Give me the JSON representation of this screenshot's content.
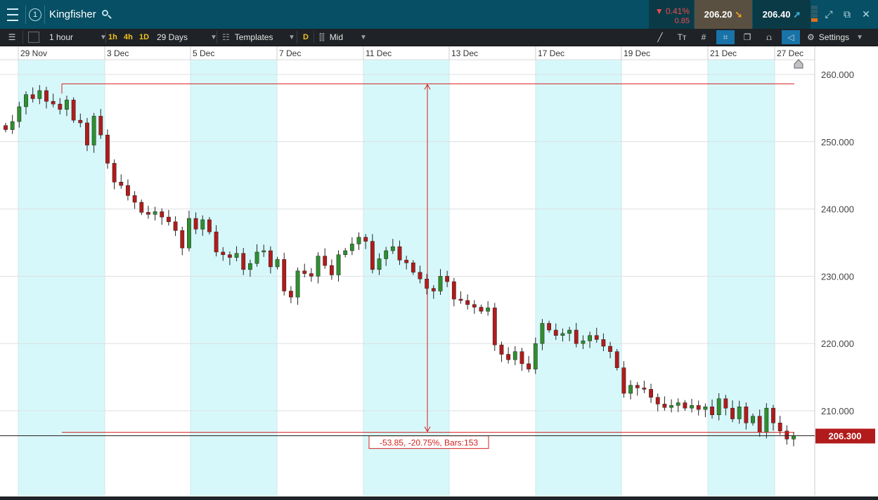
{
  "header": {
    "instrument": "Kingfisher",
    "window_number": "1",
    "change_pct": "▼ 0.41%",
    "change_abs": "0.85",
    "sell_price": "206.20",
    "buy_price": "206.40"
  },
  "toolbar": {
    "interval": "1 hour",
    "quick_1h": "1h",
    "quick_4h": "4h",
    "quick_1d": "1D",
    "range": "29 Days",
    "templates": "Templates",
    "d_button": "D",
    "price_type": "Mid",
    "settings": "Settings"
  },
  "colors": {
    "header_bg": "#064f64",
    "toolbar_bg": "#1f2226",
    "up_candle": "#2f8f2f",
    "down_candle": "#b21b1b",
    "day_band": "#d7f8fa",
    "measure_line": "#d42020",
    "price_tag": "#b21b1b"
  },
  "chart_data": {
    "type": "candlestick",
    "x_labels": [
      "29 Nov",
      "3 Dec",
      "5 Dec",
      "7 Dec",
      "11 Dec",
      "13 Dec",
      "17 Dec",
      "19 Dec",
      "21 Dec",
      "27 Dec"
    ],
    "ylim": [
      200.0,
      262.0
    ],
    "y_ticks": [
      260.0,
      250.0,
      240.0,
      230.0,
      220.0,
      210.0
    ],
    "y_tick_labels": [
      "260.000",
      "250.000",
      "240.000",
      "230.000",
      "220.000",
      "210.000"
    ],
    "last_price": 206.3,
    "last_price_label": "206.300",
    "measurement": {
      "high": 258.6,
      "low": 206.8,
      "label": "-53.85, -20.75%, Bars:153"
    },
    "closes": [
      251.8,
      253.0,
      255.2,
      257.0,
      256.4,
      257.6,
      256.0,
      255.6,
      254.8,
      256.2,
      253.2,
      252.8,
      249.5,
      253.8,
      251.0,
      246.8,
      244.0,
      243.5,
      242.0,
      241.0,
      239.5,
      239.2,
      239.6,
      238.8,
      238.1,
      236.8,
      234.2,
      238.6,
      237.0,
      238.4,
      236.6,
      233.6,
      233.2,
      232.8,
      233.4,
      231.0,
      231.9,
      233.6,
      233.8,
      231.4,
      232.5,
      227.8,
      226.9,
      230.8,
      230.4,
      230.0,
      233.0,
      231.6,
      230.2,
      233.2,
      233.8,
      234.8,
      235.8,
      235.2,
      231.0,
      232.6,
      233.8,
      234.4,
      232.4,
      232.0,
      230.6,
      229.6,
      228.2,
      227.8,
      230.0,
      229.2,
      226.6,
      226.4,
      225.8,
      225.4,
      224.8,
      225.3,
      219.8,
      218.4,
      217.6,
      218.8,
      217.0,
      216.2,
      220.0,
      223.0,
      222.0,
      221.2,
      221.5,
      222.0,
      220.0,
      220.4,
      221.2,
      220.6,
      219.6,
      218.8,
      216.4,
      212.6,
      213.8,
      213.4,
      213.2,
      212.0,
      211.0,
      210.5,
      210.8,
      211.2,
      210.4,
      210.8,
      210.2,
      210.6,
      209.4,
      211.8,
      210.4,
      208.8,
      210.6,
      208.2,
      209.2,
      206.8,
      210.4,
      208.2,
      207.0,
      205.8,
      206.3
    ]
  }
}
